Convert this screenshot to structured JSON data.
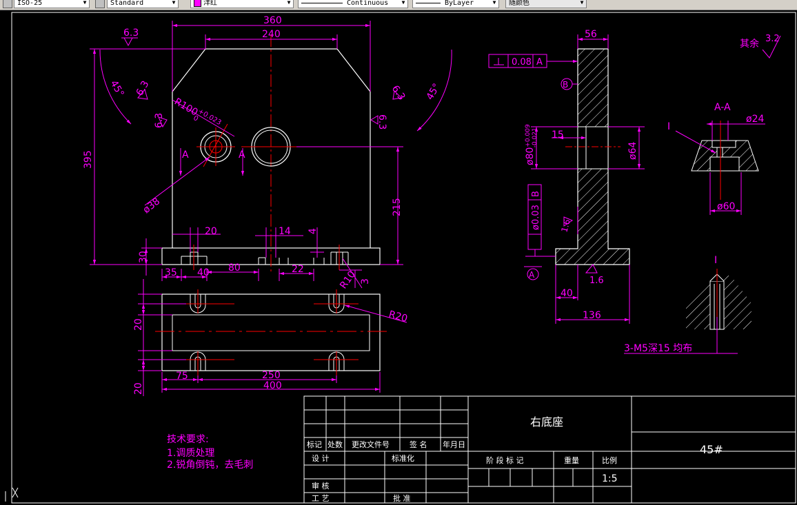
{
  "toolbar": {
    "dimstyle": "ISO-25",
    "textstyle": "Standard",
    "color": "洋红",
    "linetype": "Continuous",
    "lineweight": "ByLayer",
    "plotstyle": "随颜色"
  },
  "colors": {
    "background": "#000000",
    "dimension": "#ff00ff",
    "outline": "#ffffff",
    "centerline": "#ff0000"
  },
  "dims": {
    "w360": "360",
    "w240": "240",
    "h395": "395",
    "h215": "215",
    "r100": "R100",
    "tol_up": "+0.023",
    "tol_lo": "0",
    "d38": "ø38",
    "a45l": "45°",
    "a45r": "45°",
    "f63a": "6.3",
    "f63b": "6.3",
    "f63c": "6.3",
    "f63d": "6.3",
    "f63e": "6.3",
    "secA1": "A",
    "secA2": "A",
    "d20": "20",
    "d14": "14",
    "d4": "4",
    "d30": "30",
    "d35": "35",
    "d40": "40",
    "d80": "80",
    "d22": "22",
    "d3": "3",
    "r10": "R10",
    "d20b": "20",
    "d20c": "20",
    "d75": "75",
    "d250": "250",
    "d400": "400",
    "r20": "R20",
    "d56": "56",
    "flat_val": "0.08",
    "flat_ref": "A",
    "datum_b": "B",
    "d15": "15",
    "d80tol": "ø80",
    "tol80_up": "+0.009",
    "tol80_lo": "-0.021",
    "d64": "ø64",
    "perp_val": "ø0.03",
    "perp_ref": "B",
    "f16": "1.6",
    "f16b": "1.6",
    "datum_a": "A",
    "d40r": "40",
    "d136": "136",
    "sec_aa": "A-A",
    "d24": "ø24",
    "detail_I": "I",
    "d60": "ø60",
    "detail_I2": "I",
    "thread_note": "3-M5深15 均布",
    "rest_label": "其余",
    "rest_val": "3.2"
  },
  "tech": {
    "heading": "技术要求:",
    "line1": "1.调质处理",
    "line2": "2.锐角倒钝，去毛刺"
  },
  "titleblock": {
    "part_name": "右底座",
    "material": "45#",
    "hdr_mark": "标记",
    "hdr_count": "处数",
    "hdr_docno": "更改文件号",
    "hdr_sign": "签 名",
    "hdr_date": "年月日",
    "design": "设 计",
    "standard": "标准化",
    "check": "审 核",
    "process": "工 艺",
    "approve": "批 准",
    "stage": "阶 段 标 记",
    "weight": "重量",
    "scale_label": "比例",
    "scale": "1:5"
  }
}
